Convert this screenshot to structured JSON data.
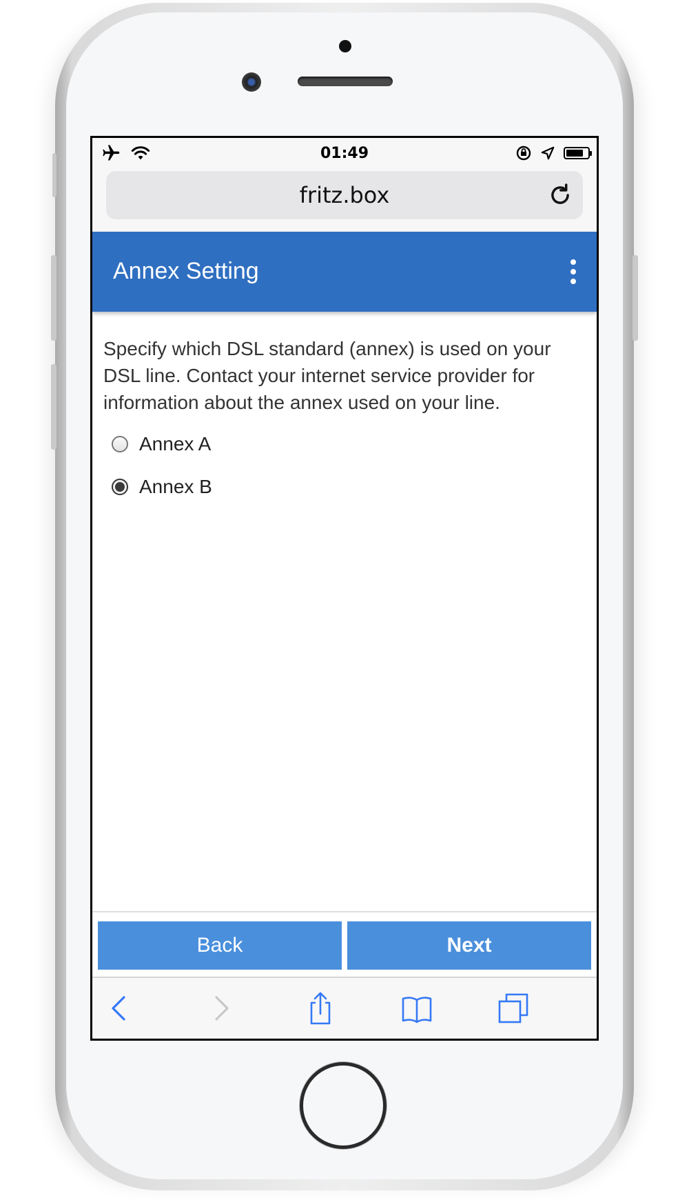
{
  "status_bar": {
    "time": "01:49",
    "left_icons": [
      "airplane-icon",
      "wifi-icon"
    ],
    "right_icons": [
      "orientation-lock-icon",
      "location-icon",
      "battery-icon"
    ]
  },
  "browser": {
    "address": "fritz.box",
    "reload_icon": "reload-icon"
  },
  "header": {
    "title": "Annex Setting",
    "menu_icon": "more-vertical-icon"
  },
  "main": {
    "description": "Specify which DSL standard (annex) is used on your DSL line. Contact your internet service provider for information about the annex used on your line.",
    "options": [
      {
        "label": "Annex A",
        "selected": false
      },
      {
        "label": "Annex B",
        "selected": true
      }
    ]
  },
  "footer": {
    "back_label": "Back",
    "next_label": "Next"
  },
  "safari_toolbar": {
    "icons": [
      "back-icon",
      "forward-icon",
      "share-icon",
      "bookmarks-icon",
      "tabs-icon"
    ],
    "accent_color": "#3478f6",
    "disabled_color": "#c7c7cc"
  },
  "colors": {
    "header_bg": "#2f6fc1",
    "button_bg": "#4a8fdc"
  }
}
